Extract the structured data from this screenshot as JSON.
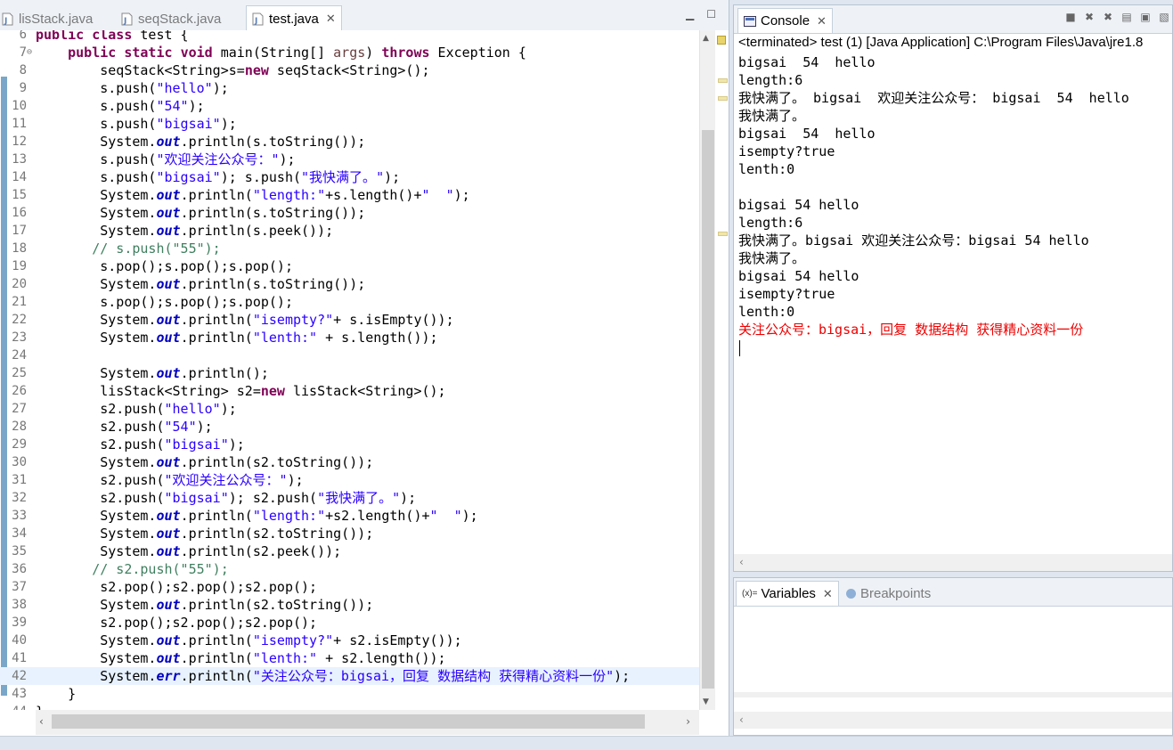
{
  "editor": {
    "tabs": [
      {
        "label": "lisStack.java",
        "active": false
      },
      {
        "label": "seqStack.java",
        "active": false
      },
      {
        "label": "test.java",
        "active": true
      }
    ],
    "lines": [
      {
        "n": "6",
        "text": "public class test {"
      },
      {
        "n": "7",
        "text": "    public static void main(String[] args) throws Exception {"
      },
      {
        "n": "8",
        "text": "        seqStack<String>s=new seqStack<String>();"
      },
      {
        "n": "9",
        "text": "        s.push(\"hello\");"
      },
      {
        "n": "10",
        "text": "        s.push(\"54\");"
      },
      {
        "n": "11",
        "text": "        s.push(\"bigsai\");"
      },
      {
        "n": "12",
        "text": "        System.out.println(s.toString());"
      },
      {
        "n": "13",
        "text": "        s.push(\"欢迎关注公众号：\");"
      },
      {
        "n": "14",
        "text": "        s.push(\"bigsai\"); s.push(\"我快满了。\");"
      },
      {
        "n": "15",
        "text": "        System.out.println(\"length:\"+s.length()+\"  \");"
      },
      {
        "n": "16",
        "text": "        System.out.println(s.toString());"
      },
      {
        "n": "17",
        "text": "        System.out.println(s.peek());"
      },
      {
        "n": "18",
        "text": "       // s.push(\"55\");"
      },
      {
        "n": "19",
        "text": "        s.pop();s.pop();s.pop();"
      },
      {
        "n": "20",
        "text": "        System.out.println(s.toString());"
      },
      {
        "n": "21",
        "text": "        s.pop();s.pop();s.pop();"
      },
      {
        "n": "22",
        "text": "        System.out.println(\"isempty?\"+ s.isEmpty());"
      },
      {
        "n": "23",
        "text": "        System.out.println(\"lenth:\" + s.length());"
      },
      {
        "n": "24",
        "text": ""
      },
      {
        "n": "25",
        "text": "        System.out.println();"
      },
      {
        "n": "26",
        "text": "        lisStack<String> s2=new lisStack<String>();"
      },
      {
        "n": "27",
        "text": "        s2.push(\"hello\");"
      },
      {
        "n": "28",
        "text": "        s2.push(\"54\");"
      },
      {
        "n": "29",
        "text": "        s2.push(\"bigsai\");"
      },
      {
        "n": "30",
        "text": "        System.out.println(s2.toString());"
      },
      {
        "n": "31",
        "text": "        s2.push(\"欢迎关注公众号：\");"
      },
      {
        "n": "32",
        "text": "        s2.push(\"bigsai\"); s2.push(\"我快满了。\");"
      },
      {
        "n": "33",
        "text": "        System.out.println(\"length:\"+s2.length()+\"  \");"
      },
      {
        "n": "34",
        "text": "        System.out.println(s2.toString());"
      },
      {
        "n": "35",
        "text": "        System.out.println(s2.peek());"
      },
      {
        "n": "36",
        "text": "       // s2.push(\"55\");"
      },
      {
        "n": "37",
        "text": "        s2.pop();s2.pop();s2.pop();"
      },
      {
        "n": "38",
        "text": "        System.out.println(s2.toString());"
      },
      {
        "n": "39",
        "text": "        s2.pop();s2.pop();s2.pop();"
      },
      {
        "n": "40",
        "text": "        System.out.println(\"isempty?\"+ s2.isEmpty());"
      },
      {
        "n": "41",
        "text": "        System.out.println(\"lenth:\" + s2.length());"
      },
      {
        "n": "42",
        "text": "        System.err.println(\"关注公众号：bigsai，回复 数据结构 获得精心资料一份\");"
      },
      {
        "n": "43",
        "text": "    }"
      },
      {
        "n": "44",
        "text": "}"
      }
    ],
    "current_line": "42"
  },
  "console": {
    "tab_label": "Console",
    "terminated_text": "<terminated> test (1) [Java Application] C:\\Program Files\\Java\\jre1.8",
    "output": [
      {
        "text": "bigsai  54  hello",
        "stream": "out"
      },
      {
        "text": "length:6",
        "stream": "out"
      },
      {
        "text": "我快满了。 bigsai  欢迎关注公众号： bigsai  54  hello",
        "stream": "out"
      },
      {
        "text": "我快满了。",
        "stream": "out"
      },
      {
        "text": "bigsai  54  hello",
        "stream": "out"
      },
      {
        "text": "isempty?true",
        "stream": "out"
      },
      {
        "text": "lenth:0",
        "stream": "out"
      },
      {
        "text": "",
        "stream": "out"
      },
      {
        "text": "bigsai 54 hello",
        "stream": "out"
      },
      {
        "text": "length:6",
        "stream": "out"
      },
      {
        "text": "我快满了。bigsai 欢迎关注公众号：bigsai 54 hello",
        "stream": "out"
      },
      {
        "text": "我快满了。",
        "stream": "out"
      },
      {
        "text": "bigsai 54 hello",
        "stream": "out"
      },
      {
        "text": "isempty?true",
        "stream": "out"
      },
      {
        "text": "lenth:0",
        "stream": "out"
      },
      {
        "text": "关注公众号：bigsai，回复 数据结构 获得精心资料一份",
        "stream": "err"
      }
    ]
  },
  "variables": {
    "tab_label": "Variables",
    "breakpoints_label": "Breakpoints"
  },
  "colors": {
    "keyword": "#7f0055",
    "string": "#2a00ff",
    "static_field": "#0000c0",
    "comment": "#3f7f5f",
    "stderr": "#ee0000"
  }
}
